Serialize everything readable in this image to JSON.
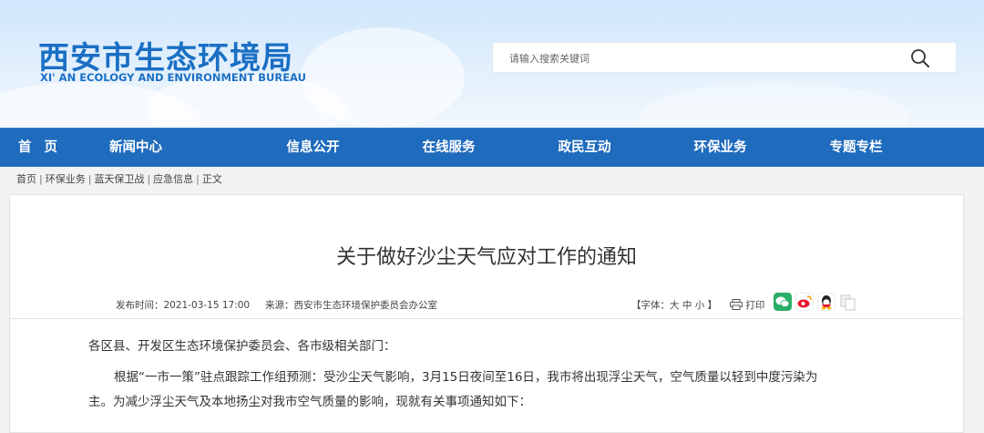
{
  "header": {
    "title_cn": "西安市生态环境局",
    "title_en": "XI' AN ECOLOGY AND ENVIRONMENT BUREAU",
    "search_placeholder": "请输入搜索关键词"
  },
  "nav": {
    "items": [
      "首页",
      "新闻中心",
      "信息公开",
      "在线服务",
      "政民互动",
      "环保业务",
      "专题专栏"
    ]
  },
  "breadcrumb": {
    "items": [
      "首页",
      "环保业务",
      "蓝天保卫战",
      "应急信息",
      "正文"
    ],
    "separator": "|"
  },
  "article": {
    "title": "关于做好沙尘天气应对工作的通知",
    "publish_time": "发布时间：2021-03-15 17:00",
    "source": "来源：西安市生态环境保护委员会办公室",
    "font_label_prefix": "【字体：",
    "font_sizes": [
      "大",
      "中",
      "小"
    ],
    "font_label_suffix": "】",
    "print_label": "打印",
    "share_icons": [
      "wechat-icon",
      "weibo-icon",
      "qq-icon",
      "copy-icon"
    ],
    "paragraphs": [
      "各区县、开发区生态环境保护委员会、各市级相关部门：",
      "根据“一市一策”驻点跟踪工作组预测：受沙尘天气影响，3月15日夜间至16日，我市将出现浮尘天气，空气质量以轻到中度污染为",
      "主。为减少浮尘天气及本地扬尘对我市空气质量的影响，现就有关事项通知如下："
    ]
  },
  "colors": {
    "nav_bg": "#1f6bbd",
    "logo": "#1a6fc4",
    "wechat": "#2aae67",
    "weibo": "#e6162d",
    "qq": "#3b9ae2"
  }
}
